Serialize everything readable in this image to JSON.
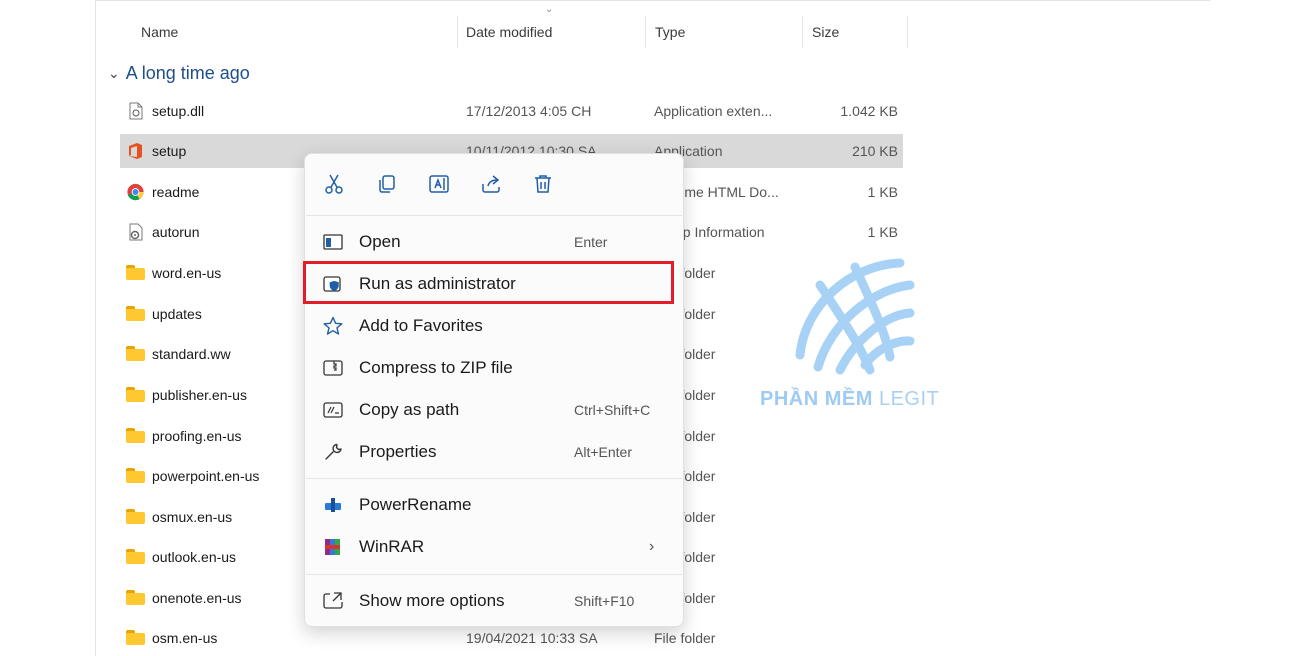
{
  "columns": {
    "name": "Name",
    "date": "Date modified",
    "type": "Type",
    "size": "Size"
  },
  "group_label": "A long time ago",
  "files": [
    {
      "name": "setup.dll",
      "date": "17/12/2013 4:05 CH",
      "type": "Application exten...",
      "size": "1.042 KB",
      "icon": "dll-file-icon"
    },
    {
      "name": "setup",
      "date": "10/11/2012 10:30 SA",
      "type": "Application",
      "size": "210 KB",
      "icon": "office-setup-icon",
      "selected": true
    },
    {
      "name": "readme",
      "date": "",
      "type": "Chrome HTML Do...",
      "size": "1 KB",
      "icon": "chrome-icon"
    },
    {
      "name": "autorun",
      "date": "",
      "type": "Setup Information",
      "size": "1 KB",
      "icon": "settings-file-icon"
    },
    {
      "name": "word.en-us",
      "date": "",
      "type": "File folder",
      "size": "",
      "icon": "folder-icon"
    },
    {
      "name": "updates",
      "date": "",
      "type": "File folder",
      "size": "",
      "icon": "folder-icon"
    },
    {
      "name": "standard.ww",
      "date": "",
      "type": "File folder",
      "size": "",
      "icon": "folder-icon"
    },
    {
      "name": "publisher.en-us",
      "date": "",
      "type": "File folder",
      "size": "",
      "icon": "folder-icon"
    },
    {
      "name": "proofing.en-us",
      "date": "",
      "type": "File folder",
      "size": "",
      "icon": "folder-icon"
    },
    {
      "name": "powerpoint.en-us",
      "date": "",
      "type": "File folder",
      "size": "",
      "icon": "folder-icon"
    },
    {
      "name": "osmux.en-us",
      "date": "",
      "type": "File folder",
      "size": "",
      "icon": "folder-icon"
    },
    {
      "name": "outlook.en-us",
      "date": "",
      "type": "File folder",
      "size": "",
      "icon": "folder-icon"
    },
    {
      "name": "onenote.en-us",
      "date": "",
      "type": "File folder",
      "size": "",
      "icon": "folder-icon"
    },
    {
      "name": "osm.en-us",
      "date": "19/04/2021 10:33 SA",
      "type": "File folder",
      "size": "",
      "icon": "folder-icon"
    }
  ],
  "context_menu": {
    "quick_actions": [
      "cut-icon",
      "copy-icon",
      "rename-icon",
      "share-icon",
      "delete-icon"
    ],
    "items": [
      {
        "label": "Open",
        "shortcut": "Enter",
        "icon": "open-window-icon"
      },
      {
        "label": "Run as administrator",
        "shortcut": "",
        "icon": "shield-window-icon",
        "highlighted": true
      },
      {
        "label": "Add to Favorites",
        "shortcut": "",
        "icon": "star-icon"
      },
      {
        "label": "Compress to ZIP file",
        "shortcut": "",
        "icon": "zip-icon"
      },
      {
        "label": "Copy as path",
        "shortcut": "Ctrl+Shift+C",
        "icon": "path-icon"
      },
      {
        "label": "Properties",
        "shortcut": "Alt+Enter",
        "icon": "wrench-icon"
      },
      {
        "label": "PowerRename",
        "shortcut": "",
        "icon": "powerrename-icon"
      },
      {
        "label": "WinRAR",
        "shortcut": "",
        "icon": "winrar-icon",
        "submenu": "›"
      },
      {
        "label": "Show more options",
        "shortcut": "Shift+F10",
        "icon": "more-options-icon"
      }
    ]
  },
  "watermark": {
    "brand": "PHẦN MỀM",
    "suffix": "LEGIT"
  },
  "colors": {
    "highlight_border": "#e21d2a",
    "group_label": "#1f4e8c",
    "folder": "#ffc730",
    "selected_row": "#d9d9d9"
  }
}
